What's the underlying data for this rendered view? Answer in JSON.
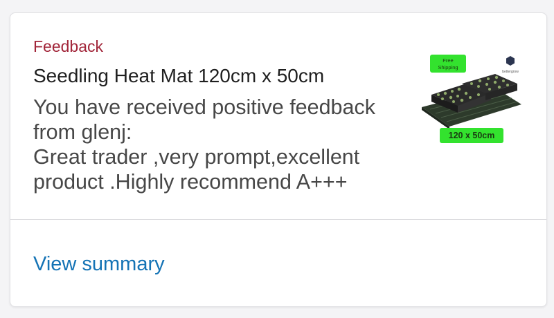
{
  "notification": {
    "category": "Feedback",
    "title": "Seedling Heat Mat 120cm x 50cm",
    "message_lines": [
      "You have received positive feedback",
      "from glenj:",
      "Great trader ,very prompt,excellent",
      "product .Highly recommend A+++"
    ],
    "action_label": "View summary"
  },
  "thumbnail": {
    "badge_line1": "Free",
    "badge_line2": "Shipping",
    "size_label": "120 x 50cm",
    "brand_text": "bettergrow"
  },
  "colors": {
    "category": "#a2263a",
    "link": "#1473b5",
    "badge_green": "#33e22e"
  }
}
